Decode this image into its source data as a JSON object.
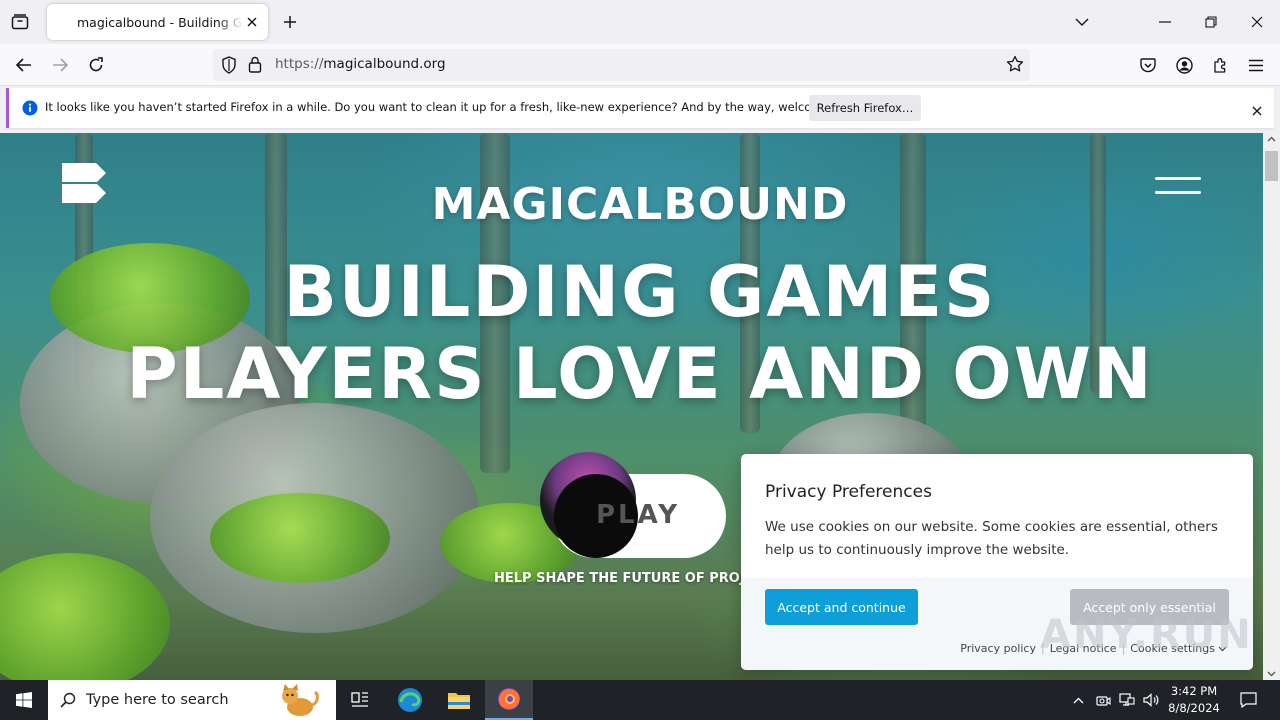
{
  "browser": {
    "tab": {
      "title": "magicalbound - Building Games"
    },
    "url": {
      "protocol": "https://",
      "host": "magicalbound.org"
    },
    "notification": {
      "message": "It looks like you haven’t started Firefox in a while. Do you want to clean it up for a fresh, like-new experience? And by the way, welcome back!",
      "button": "Refresh Firefox…"
    }
  },
  "page": {
    "brand": "MAGICALBOUND",
    "headline_line1": "BUILDING GAMES",
    "headline_line2": "PLAYERS LOVE AND OWN",
    "play_label": "PLAY",
    "tagline": "HELP SHAPE THE FUTURE OF PROJ"
  },
  "privacy": {
    "title": "Privacy Preferences",
    "body": "We use cookies on our website. Some cookies are essential, others help us to continuously improve the website.",
    "accept_button": "Accept and continue",
    "essential_button": "Accept only essential",
    "links": {
      "privacy_policy": "Privacy policy",
      "legal_notice": "Legal notice",
      "cookie_settings": "Cookie settings"
    }
  },
  "watermark": "ANY.RUN",
  "taskbar": {
    "search_placeholder": "Type here to search",
    "time": "3:42 PM",
    "date": "8/8/2024"
  },
  "colors": {
    "accent_button": "#0e9fd8",
    "disabled_button": "#b8bcc2",
    "notification_accent": "#a25ad8",
    "taskbar": "#1f2327"
  }
}
